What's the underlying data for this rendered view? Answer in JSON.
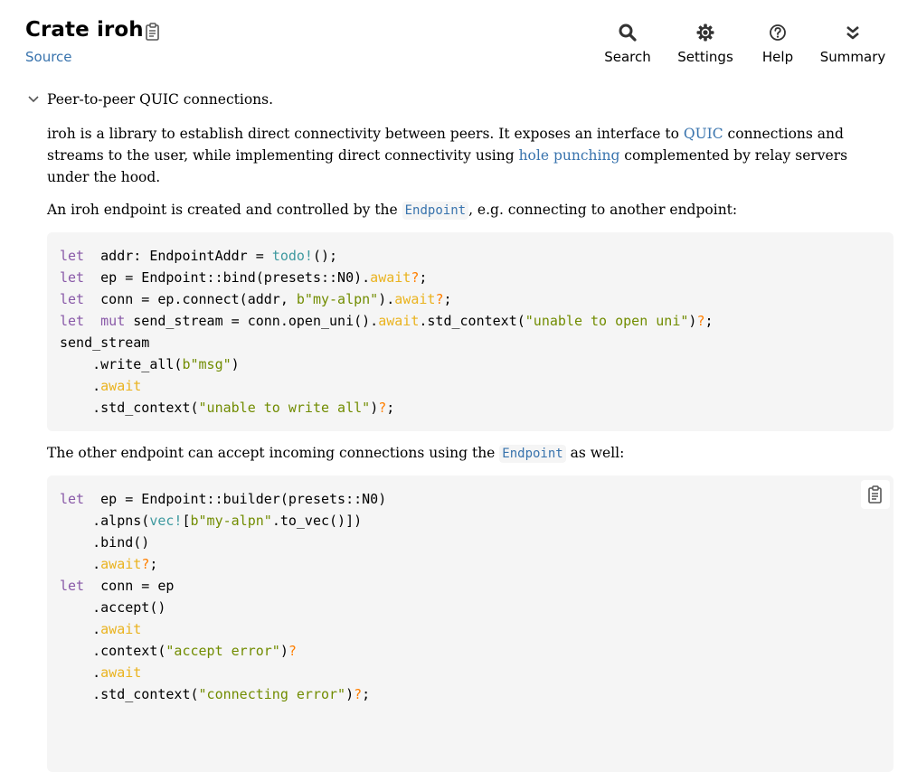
{
  "header": {
    "title": "Crate iroh",
    "source_label": "Source",
    "copy_path_icon": "clipboard-icon"
  },
  "toolbar": {
    "search_label": "Search",
    "settings_label": "Settings",
    "help_label": "Help",
    "summary_label": "Summary"
  },
  "doc": {
    "toggle_summary": "Peer-to-peer QUIC connections.",
    "p1_a": "iroh is a library to establish direct connectivity between peers. It exposes an interface to ",
    "p1_link1": "QUIC",
    "p1_b": " connections and streams to the user, while implementing direct connectivity using ",
    "p1_link2": "hole punching",
    "p1_c": " complemented by relay servers under the hood.",
    "p2_a": "An iroh endpoint is created and controlled by the ",
    "p2_code": "Endpoint",
    "p2_b": ", e.g. connecting to another endpoint:",
    "p3_a": "The other endpoint can accept incoming connections using the ",
    "p3_code": "Endpoint",
    "p3_b": " as well:"
  },
  "code1": {
    "lines": [
      [
        [
          "kw",
          "let"
        ],
        [
          "",
          "  addr: EndpointAddr = "
        ],
        [
          "mac",
          "todo!"
        ],
        [
          "",
          "();"
        ]
      ],
      [
        [
          "kw",
          "let"
        ],
        [
          "",
          "  ep = Endpoint::bind(presets::N0)."
        ],
        [
          "aw",
          "await"
        ],
        [
          "q",
          "?"
        ],
        [
          "",
          ";"
        ]
      ],
      [
        [
          "kw",
          "let"
        ],
        [
          "",
          "  conn = ep.connect(addr, "
        ],
        [
          "str",
          "b\"my-alpn\""
        ],
        [
          "",
          ")."
        ],
        [
          "aw",
          "await"
        ],
        [
          "q",
          "?"
        ],
        [
          "",
          ";"
        ]
      ],
      [
        [
          "kw",
          "let"
        ],
        [
          "",
          "  "
        ],
        [
          "kw",
          "mut"
        ],
        [
          "",
          " send_stream = conn.open_uni()."
        ],
        [
          "aw",
          "await"
        ],
        [
          "",
          ".std_context("
        ],
        [
          "str",
          "\"unable to open uni\""
        ],
        [
          "",
          ")"
        ],
        [
          "q",
          "?"
        ],
        [
          "",
          ";"
        ]
      ],
      [
        [
          "",
          "send_stream"
        ]
      ],
      [
        [
          "",
          "    .write_all("
        ],
        [
          "str",
          "b\"msg\""
        ],
        [
          "",
          ")"
        ]
      ],
      [
        [
          "",
          "    ."
        ],
        [
          "aw",
          "await"
        ]
      ],
      [
        [
          "",
          "    .std_context("
        ],
        [
          "str",
          "\"unable to write all\""
        ],
        [
          "",
          ")"
        ],
        [
          "q",
          "?"
        ],
        [
          "",
          ";"
        ]
      ]
    ]
  },
  "code2": {
    "copy_icon": "clipboard-icon",
    "lines": [
      [
        [
          "kw",
          "let"
        ],
        [
          "",
          "  ep = Endpoint::builder(presets::N0)"
        ]
      ],
      [
        [
          "",
          "    .alpns("
        ],
        [
          "mac",
          "vec!"
        ],
        [
          "",
          "["
        ],
        [
          "str",
          "b\"my-alpn\""
        ],
        [
          "",
          ".to_vec()])"
        ]
      ],
      [
        [
          "",
          "    .bind()"
        ]
      ],
      [
        [
          "",
          "    ."
        ],
        [
          "aw",
          "await"
        ],
        [
          "q",
          "?"
        ],
        [
          "",
          ";"
        ]
      ],
      [
        [
          "kw",
          "let"
        ],
        [
          "",
          "  conn = ep"
        ]
      ],
      [
        [
          "",
          "    .accept()"
        ]
      ],
      [
        [
          "",
          "    ."
        ],
        [
          "aw",
          "await"
        ]
      ],
      [
        [
          "",
          "    .context("
        ],
        [
          "str",
          "\"accept error\""
        ],
        [
          "",
          ")"
        ],
        [
          "q",
          "?"
        ]
      ],
      [
        [
          "",
          "    ."
        ],
        [
          "aw",
          "await"
        ]
      ],
      [
        [
          "",
          "    .std_context("
        ],
        [
          "str",
          "\"connecting error\""
        ],
        [
          "",
          ")"
        ],
        [
          "q",
          "?"
        ],
        [
          "",
          ";"
        ]
      ]
    ]
  }
}
